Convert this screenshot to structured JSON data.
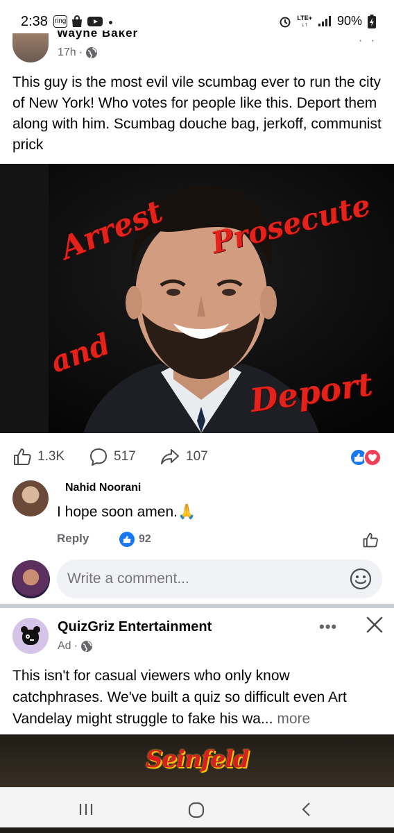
{
  "status_bar": {
    "time": "2:38",
    "ring_label": "ring",
    "network": "LTE+",
    "battery": "90%"
  },
  "post": {
    "author_cut": "Wayne Baker",
    "time": "17h",
    "more": "· ·",
    "text": "This guy is the most evil vile scumbag ever to run the city of New York! Who votes for people like this. Deport them along with him. Scumbag douche bag, jerkoff, communist prick",
    "image_words": {
      "arrest": "Arrest",
      "prosecute": "Prosecute",
      "and": "and",
      "deport": "Deport"
    },
    "likes": "1.3K",
    "comments": "517",
    "shares": "107"
  },
  "comment": {
    "author": "Nahid Noorani",
    "text": "I hope soon amen.🙏",
    "reply_label": "Reply",
    "likes": "92"
  },
  "composer": {
    "placeholder": "Write a comment..."
  },
  "ad": {
    "name": "QuizGriz Entertainment",
    "label": "Ad",
    "more_dots": "•••",
    "text": "This isn't for casual viewers who only know catchphrases. We've built a quiz so difficult even Art Vandelay might struggle to fake his wa...",
    "more_label": "more",
    "image_title": "Seinfeld"
  },
  "colors": {
    "fb_blue": "#1877f2",
    "love_red": "#f33e58",
    "overlay_red": "#e3231b",
    "secondary_text": "#65676b"
  }
}
